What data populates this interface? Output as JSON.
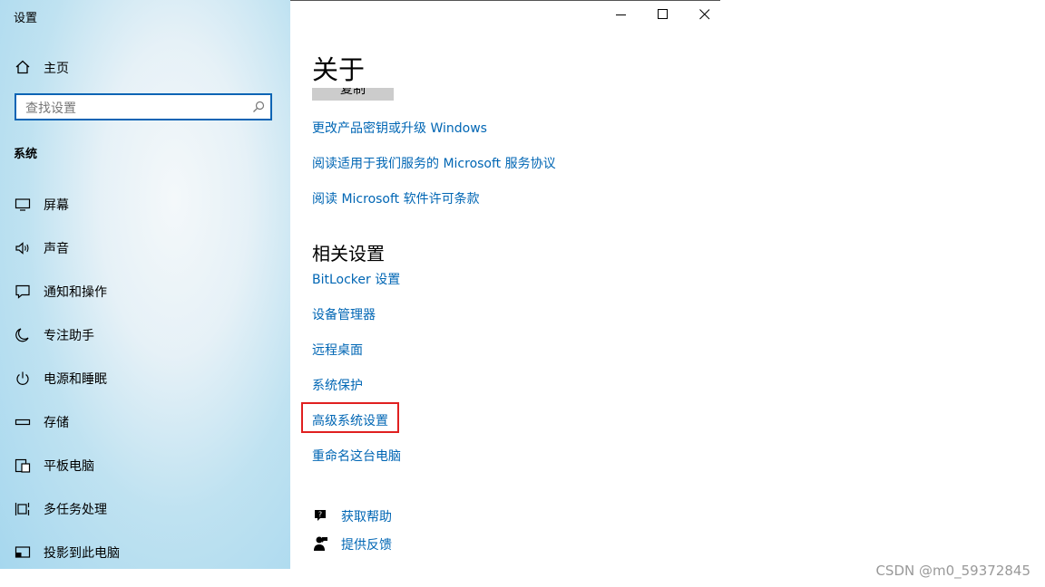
{
  "window": {
    "title": "设置"
  },
  "sidebar": {
    "home_label": "主页",
    "search": {
      "placeholder": "查找设置",
      "value": ""
    },
    "section_title": "系统",
    "items": [
      {
        "label": "屏幕",
        "icon": "monitor-icon"
      },
      {
        "label": "声音",
        "icon": "speaker-icon"
      },
      {
        "label": "通知和操作",
        "icon": "notification-icon"
      },
      {
        "label": "专注助手",
        "icon": "moon-icon"
      },
      {
        "label": "电源和睡眠",
        "icon": "power-icon"
      },
      {
        "label": "存储",
        "icon": "storage-icon"
      },
      {
        "label": "平板电脑",
        "icon": "tablet-icon"
      },
      {
        "label": "多任务处理",
        "icon": "multitask-icon"
      },
      {
        "label": "投影到此电脑",
        "icon": "project-icon"
      }
    ]
  },
  "main": {
    "title": "关于",
    "copy_button": "复制",
    "links": [
      "更改产品密钥或升级 Windows",
      "阅读适用于我们服务的 Microsoft 服务协议",
      "阅读 Microsoft 软件许可条款"
    ],
    "related_title": "相关设置",
    "related_links": [
      "BitLocker 设置",
      "设备管理器",
      "远程桌面",
      "系统保护",
      "高级系统设置",
      "重命名这台电脑"
    ],
    "help": [
      {
        "label": "获取帮助",
        "icon": "help-chat-icon"
      },
      {
        "label": "提供反馈",
        "icon": "feedback-icon"
      }
    ],
    "highlight_color": "#e02020",
    "link_color": "#0066b4"
  },
  "watermark": "CSDN @m0_59372845"
}
